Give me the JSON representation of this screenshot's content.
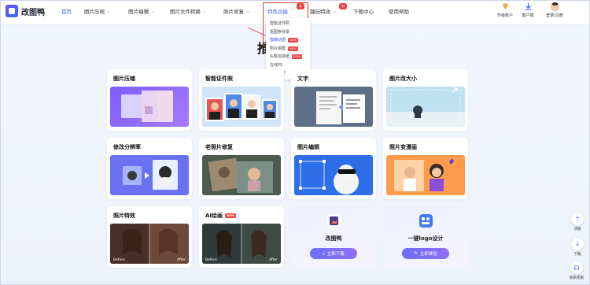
{
  "app": {
    "name": "改图鸭"
  },
  "nav": {
    "items": [
      {
        "label": "首页",
        "has_chevron": false
      },
      {
        "label": "图片压缩",
        "has_chevron": true
      },
      {
        "label": "图片编辑",
        "has_chevron": true
      },
      {
        "label": "图片文件转换",
        "has_chevron": true
      },
      {
        "label": "照片修复",
        "has_chevron": true
      },
      {
        "label": "特色功能",
        "has_chevron": true,
        "badge": "新"
      },
      {
        "label": "趣玩特效",
        "has_chevron": true,
        "badge": "新"
      },
      {
        "label": "下载中心",
        "has_chevron": false
      },
      {
        "label": "使用帮助",
        "has_chevron": false
      }
    ]
  },
  "header_right": {
    "upgrade": "升级账户",
    "client": "客户端",
    "login": "登录/注册"
  },
  "dropdown": {
    "items": [
      {
        "label": "智能证件照",
        "badge": ""
      },
      {
        "label": "抠图换背景",
        "badge": ""
      },
      {
        "label": "模糊动图",
        "badge": "NEW"
      },
      {
        "label": "照片相框",
        "badge": "NEW"
      },
      {
        "label": "头像加挂纸",
        "badge": "NEW"
      },
      {
        "label": "在线PS",
        "badge": ""
      },
      {
        "label": "logo设计",
        "badge": ""
      }
    ]
  },
  "page_title_partial": "推",
  "cards": [
    {
      "title": "图片压缩"
    },
    {
      "title": "智能证件照"
    },
    {
      "title": "文字"
    },
    {
      "title": "图片改大小"
    },
    {
      "title": "修改分辨率"
    },
    {
      "title": "老照片修复"
    },
    {
      "title": "图片编辑"
    },
    {
      "title": "照片变漫画"
    },
    {
      "title": "照片特效"
    },
    {
      "title": "AI绘画",
      "badge": "NEW"
    }
  ],
  "promos": [
    {
      "name": "改图鸭",
      "button": "立即下载"
    },
    {
      "name": "一键logo设计",
      "button": "立即体验"
    }
  ],
  "side_tools": [
    {
      "label": "顶部"
    },
    {
      "label": "下载"
    },
    {
      "label": "联系客服"
    }
  ],
  "compare_labels": {
    "before": "Before",
    "after": "After"
  },
  "colors": {
    "accent": "#3b66f5",
    "badge": "#ef3b3b"
  }
}
